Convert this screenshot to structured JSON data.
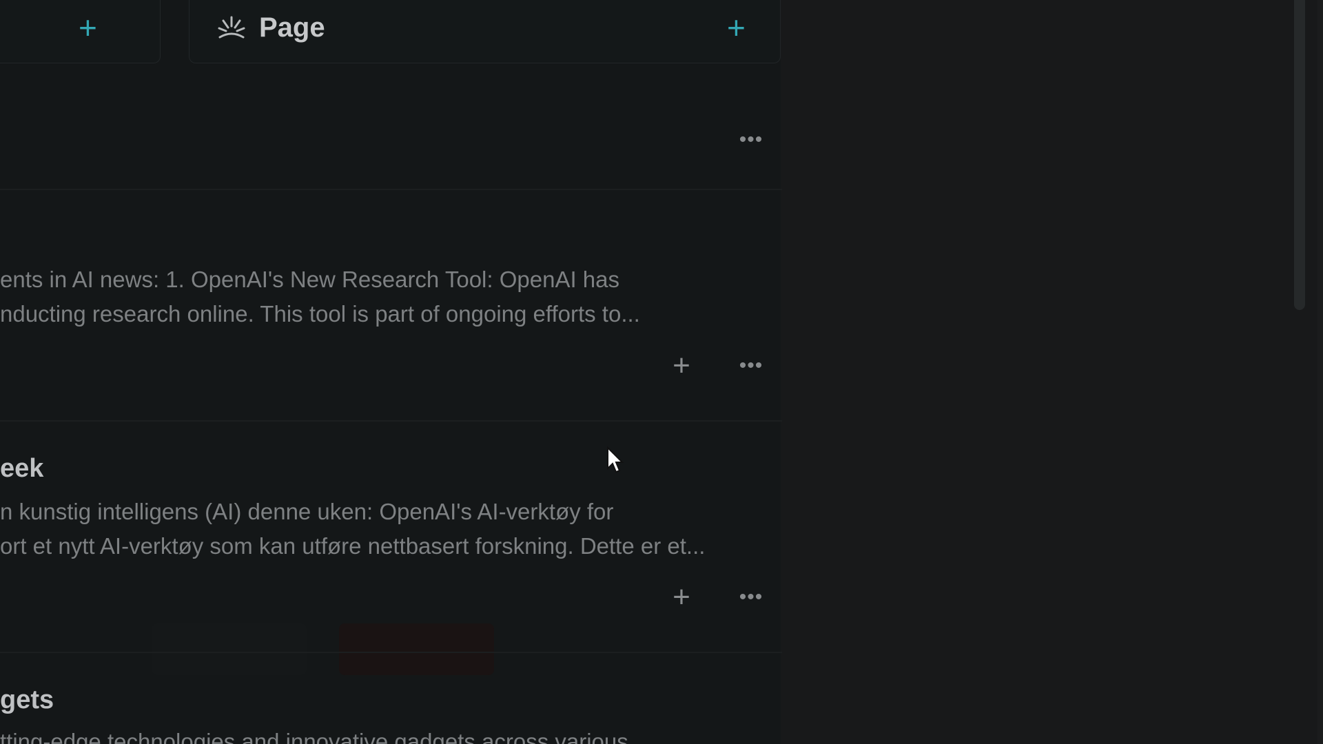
{
  "top_bar": {
    "page_label": "Page"
  },
  "cards": [
    {
      "title": "",
      "lines": [
        "ents in AI news: 1. OpenAI's New Research Tool: OpenAI has",
        "nducting research online. This tool is part of ongoing efforts to..."
      ]
    },
    {
      "title": "eek",
      "lines": [
        "n kunstig intelligens (AI) denne uken: OpenAI's AI-verktøy for",
        "ort et nytt AI-verktøy som kan utføre nettbasert forskning. Dette er et..."
      ]
    },
    {
      "title": "gets",
      "lines": [
        "tting-edge technologies and innovative gadgets across various"
      ]
    }
  ],
  "colors": {
    "accent": "#33a8b5",
    "background": "#141718"
  }
}
